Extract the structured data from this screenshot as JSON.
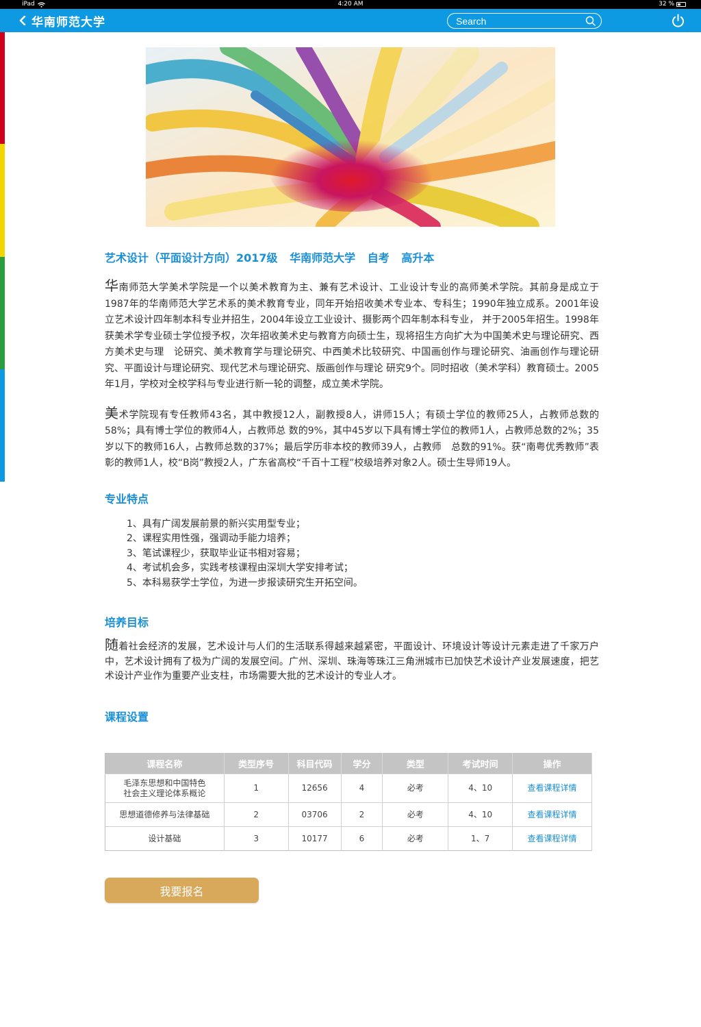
{
  "status_bar": {
    "device": "iPad",
    "time": "4:20 AM",
    "battery": "32 %",
    "battery_level": 0.32
  },
  "nav": {
    "title": "华南师范大学",
    "search_placeholder": "Search"
  },
  "accent_colors": {
    "nav": "#0d9ae3",
    "heading": "#1a8fd6",
    "button": "#d8a95a",
    "strip": [
      "#d0021b",
      "#f2d600",
      "#2a9d3f",
      "#0d9ae3"
    ]
  },
  "headline": {
    "program": "艺术设计（平面设计方向）2017级",
    "school": "华南师范大学",
    "mode": "自考",
    "level": "高升本"
  },
  "intro": {
    "p1_drop": "华",
    "p1_text": "南师范大学美术学院是一个以美术教育为主、兼有艺术设计、工业设计专业的高师美术学院。其前身是成立于1987年的华南师范大学艺术系的美术教育专业，同年开始招收美术专业本、专科生；1990年独立成系。2001年设立艺术设计四年制本科专业并招生，2004年设立工业设计、摄影两个四年制本科专业， 并于2005年招生。1998年获美术学专业硕士学位授予权，次年招收美术史与教育方向硕士生，现将招生方向扩大为中国美术史与理论研究、西方美术史与理　论研究、美术教育学与理论研究、中西美术比较研究、中国画创作与理论研究、油画创作与理论研究、平面设计与理论研究、现代艺术与理论研究、版画创作与理论 研究9个。同时招收（美术学科）教育硕士。2005年1月，学校对全校学科与专业进行新一轮的调整，成立美术学院。",
    "p2_drop": "美",
    "p2_text": "术学院现有专任教师43名，其中教授12人，副教授8人，讲师15人；有硕士学位的教师25人，占教师总数的58%；具有博士学位的教师4人，占教师总 数的9%，其中45岁以下具有博士学位的教师1人，占教师总数的2%；35岁以下的教师16人，占教师总数的37%；最后学历非本校的教师39人，占教师　总数的91%。获“南粤优秀教师”表彰的教师1人，校“B岗”教授2人，广东省高校“千百十工程”校级培养对象2人。硕士生导师19人。"
  },
  "features": {
    "title": "专业特点",
    "items": [
      "1、具有广阔发展前景的新兴实用型专业；",
      "2、课程实用性强，强调动手能力培养；",
      "3、笔试课程少，获取毕业证书相对容易；",
      "4、考试机会多，实践考核课程由深圳大学安排考试；",
      "5、本科易获学士学位，为进一步报读研究生开拓空间。"
    ]
  },
  "goals": {
    "title": "培养目标",
    "drop": "随",
    "text": "着社会经济的发展，艺术设计与人们的生活联系得越来越紧密，平面设计、环境设计等设计元素走进了千家万户中，艺术设计拥有了极为广阔的发展空间。广州、深圳、珠海等珠江三角洲城市已加快艺术设计产业发展速度，把艺术设计产业作为重要产业支柱，市场需要大批的艺术设计的专业人才。"
  },
  "courses": {
    "title": "课程设置",
    "headers": [
      "课程名称",
      "类型序号",
      "科目代码",
      "学分",
      "类型",
      "考试时间",
      "操作"
    ],
    "rows": [
      {
        "name": "毛泽东思想和中国特色\n社会主义理论体系概论",
        "seq": "1",
        "code": "12656",
        "credit": "4",
        "type": "必考",
        "time": "4、10",
        "action": "查看课程详情"
      },
      {
        "name": "思想道德修养与法律基础",
        "seq": "2",
        "code": "03706",
        "credit": "2",
        "type": "必考",
        "time": "4、10",
        "action": "查看课程详情"
      },
      {
        "name": "设计基础",
        "seq": "3",
        "code": "10177",
        "credit": "6",
        "type": "必考",
        "time": "1、7",
        "action": "查看课程详情"
      }
    ]
  },
  "apply_button": "我要报名"
}
